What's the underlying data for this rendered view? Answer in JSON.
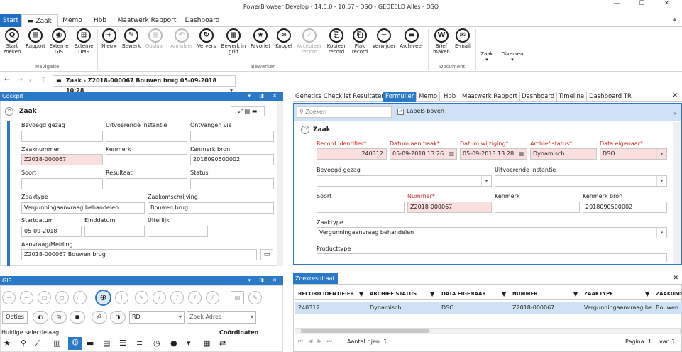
{
  "window": {
    "title": "PowerBrowser Develop - 14.5.0 - 10:57 - DSO - GEDEELD Alles - DSO",
    "controls": "— ☐ ✕"
  },
  "ribbon_tabs": [
    "Start",
    "Zaak",
    "Memo",
    "Hbb",
    "Maatwerk Rapport",
    "Dashboard"
  ],
  "ribbon_buttons": [
    {
      "label": "Start\nzoeken",
      "icon": "Q"
    },
    {
      "label": "Rapport",
      "icon": "▤"
    },
    {
      "label": "Externe\nGIS",
      "icon": "◉"
    },
    {
      "label": "Externe\nDMS",
      "icon": "⊞"
    },
    {
      "label": "Nieuw",
      "icon": "+"
    },
    {
      "label": "Bewerk",
      "icon": "✎"
    },
    {
      "label": "Opslaan",
      "icon": "▤"
    },
    {
      "label": "Annuleer",
      "icon": "↶"
    },
    {
      "label": "Ververs",
      "icon": "↻"
    },
    {
      "label": "Bewerk in\ngrid",
      "icon": "▦"
    },
    {
      "label": "Favoriet",
      "icon": "★"
    },
    {
      "label": "Koppel",
      "icon": "∞"
    },
    {
      "label": "Accepteer\nrecord",
      "icon": "✓"
    },
    {
      "label": "Kopieer\nrecord",
      "icon": "⎘"
    },
    {
      "label": "Plak\nrecord",
      "icon": "⎗"
    },
    {
      "label": "Verwijder",
      "icon": "−"
    },
    {
      "label": "Archiveer",
      "icon": "▬"
    },
    {
      "label": "Brief\nmaken",
      "icon": "W"
    },
    {
      "label": "E-mail",
      "icon": "✉"
    }
  ],
  "ribbon_dropdowns": [
    "Zaak",
    "Diversen"
  ],
  "ribbon_groups": [
    "Navigatie",
    "Bewerken",
    "Document"
  ],
  "address": {
    "text": "Zaak - Z2018-000067 Bouwen brug 05-09-2018 10:28"
  },
  "cockpit": {
    "title": "Cockpit",
    "section": "Zaak",
    "labels": {
      "bevoegd": "Bevoegd gezag",
      "uitvoerende": "Uitvoerende instantie",
      "ontvangen": "Ontvangen via",
      "zaaknummer": "Zaaknummer",
      "kenmerk": "Kenmerk",
      "kenmerk_bron": "Kenmerk bron",
      "soort": "Soort",
      "resultaat": "Resultaat",
      "status": "Status",
      "zaaktype": "Zaaktype",
      "omschrijving": "Zaakomschrijving",
      "startdatum": "Startdatum",
      "einddatum": "Einddatum",
      "uiterlijk": "Uiterlijk",
      "aanvraag": "Aanvraag/Melding"
    },
    "values": {
      "zaaknummer": "Z2018-000067",
      "kenmerk_bron": "2018090500002",
      "zaaktype": "Vergunningaanvraag behandelen",
      "omschrijving": "Bouwen brug",
      "startdatum": "05-09-2018",
      "aanvraag": "Z2018-000067 Bouwen brug"
    }
  },
  "gis": {
    "title": "GIS",
    "opties": "Opties",
    "layer": "RD",
    "zoek_adres": "Zoek Adres",
    "huidige": "Huidige selectielaag:",
    "coordinaten": "Coördinaten"
  },
  "form_tabs": [
    "Genetics Checklist Resultaten",
    "Formulier",
    "Memo",
    "Hbb",
    "Maatwerk Rapport",
    "Dashboard",
    "Timeline",
    "Dashboard TR"
  ],
  "form": {
    "search_placeholder": "Zoeken",
    "labels_boven": "Labels boven",
    "section": "Zaak",
    "labels": {
      "record_id": "Record Identifier*",
      "datum_aanmaak": "Datum aanmaak*",
      "datum_wijziging": "Datum wijziging*",
      "archief_status": "Archief status*",
      "data_eigenaar": "Data eigenaar*",
      "bevoegd": "Bevoegd gezag",
      "uitvoerende": "Uitvoerende instantie",
      "soort": "Soort",
      "nummer": "Nummer*",
      "kenmerk": "Kenmerk",
      "kenmerk_bron": "Kenmerk bron",
      "zaaktype": "Zaaktype",
      "producttype": "Producttype"
    },
    "values": {
      "record_id": "240312",
      "datum_aanmaak": "05-09-2018 13:26",
      "datum_wijziging": "05-09-2018 13:28",
      "archief_status": "Dynamisch",
      "data_eigenaar": "DSO",
      "nummer": "Z2018-000067",
      "kenmerk_bron": "2018090500002",
      "zaaktype": "Vergunningaanvraag behandelen"
    }
  },
  "results": {
    "title": "Zoekresultaat",
    "columns": [
      "RECORD IDENTIFIER",
      "ARCHIEF STATUS",
      "DATA EIGENAAR",
      "NUMMER",
      "ZAAKTYPE",
      "ZAAKOMS"
    ],
    "row": [
      "240312",
      "Dynamisch",
      "DSO",
      "Z2018-000067",
      "Vergunningaanvraag be",
      "Bouwen"
    ],
    "aantal": "Aantal rijen: 1",
    "pagina": "Pagina",
    "page": "1",
    "van": "van 1"
  },
  "colors": {
    "accent": "#2b79c7",
    "required": "#fbdede",
    "red": "#d42020"
  }
}
